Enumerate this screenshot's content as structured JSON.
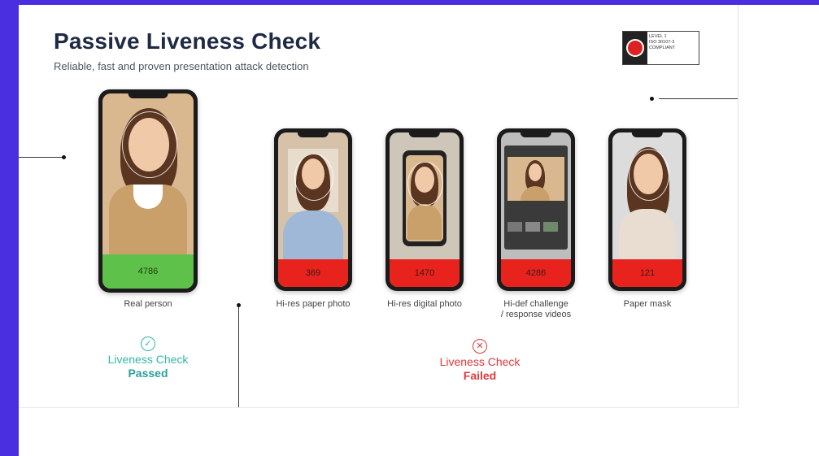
{
  "slide": {
    "title": "Passive Liveness Check",
    "subtitle": "Reliable, fast and proven presentation attack detection"
  },
  "badge": {
    "line1": "LEVEL 1",
    "line2": "ISO 30107-3",
    "line3": "COMPLIANT"
  },
  "phones": [
    {
      "score": "4786",
      "caption": "Real person"
    },
    {
      "score": "369",
      "caption": "Hi-res paper photo"
    },
    {
      "score": "1470",
      "caption": "Hi-res digital photo"
    },
    {
      "score": "4286",
      "caption": "Hi-def challenge\n/ response videos"
    },
    {
      "score": "121",
      "caption": "Paper mask"
    }
  ],
  "result_passed": {
    "icon": "check-icon",
    "line1": "Liveness Check",
    "line2": "Passed"
  },
  "result_failed": {
    "icon": "x-icon",
    "line1": "Liveness Check",
    "line2": "Failed"
  },
  "colors": {
    "frame": "#4a2fe0",
    "pass": "#5ec24a",
    "fail": "#e8231d",
    "pass_text": "#35b5a8",
    "fail_text": "#e0393e",
    "title": "#1f2a44"
  }
}
